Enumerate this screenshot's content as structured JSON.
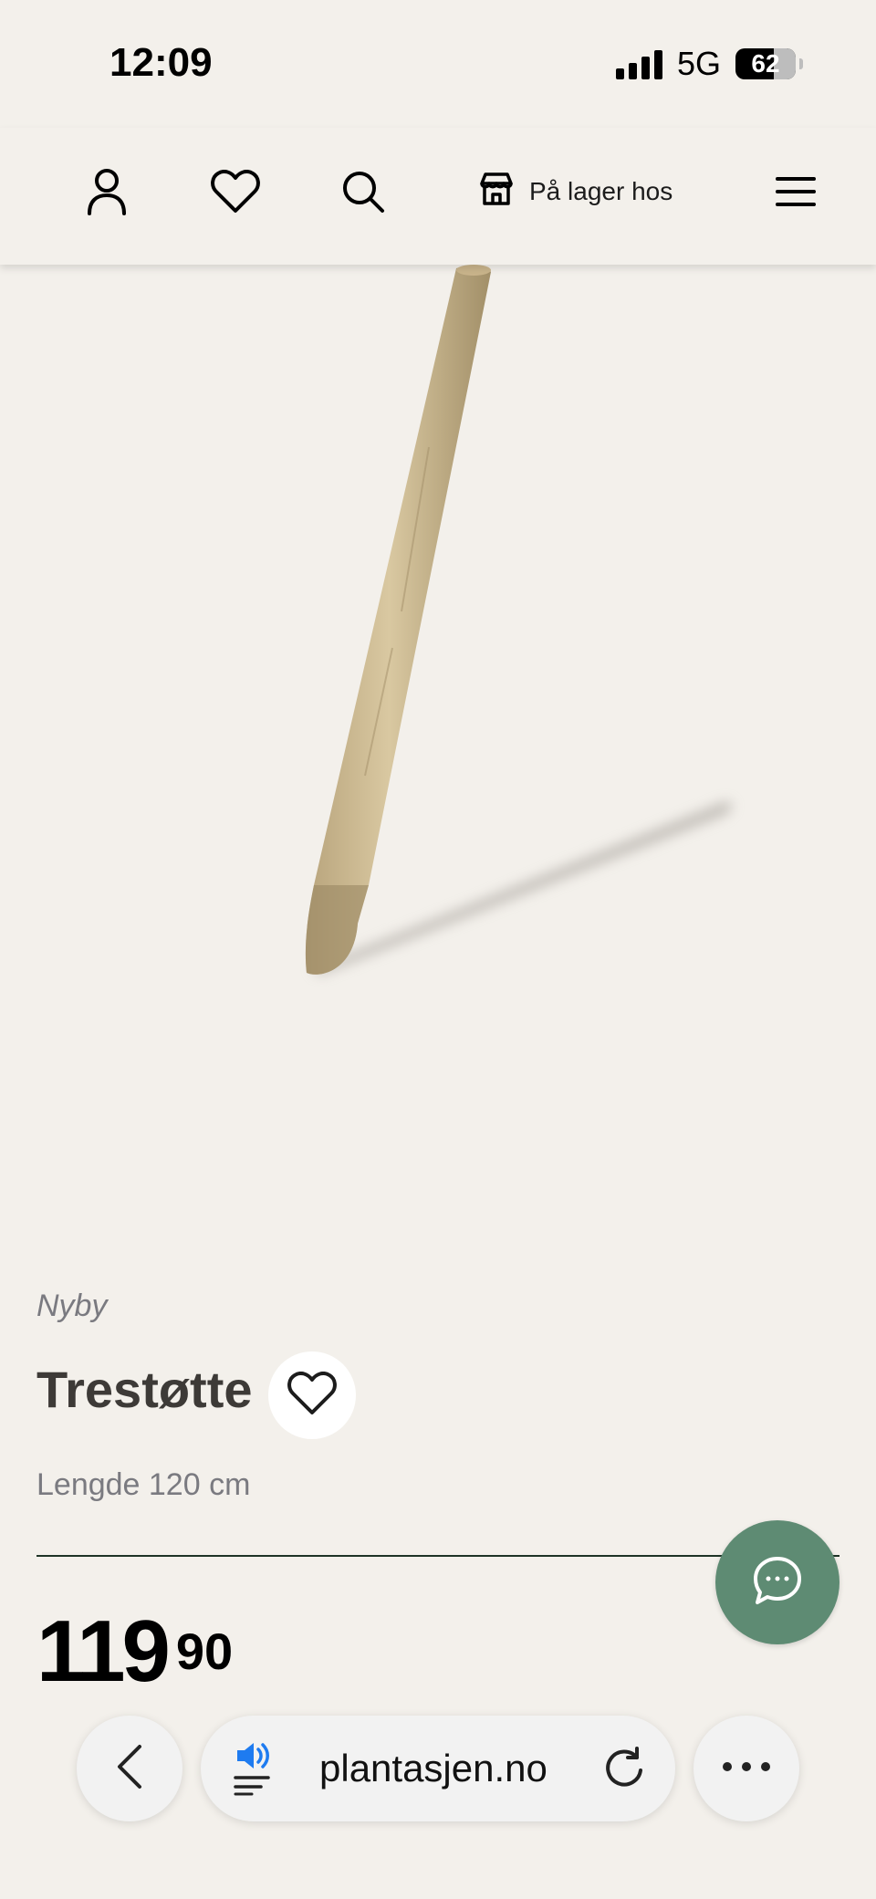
{
  "status_bar": {
    "time": "12:09",
    "network": "5G",
    "battery": "62"
  },
  "header": {
    "account_icon": "person-icon",
    "favorites_icon": "heart-icon",
    "search_icon": "search-icon",
    "store_icon": "store-icon",
    "store_label": "På lager hos",
    "menu_icon": "hamburger-menu-icon"
  },
  "product": {
    "image": "wooden-stake-image",
    "brand": "Nyby",
    "title": "Trestøtte",
    "subtitle": "Lengde 120 cm",
    "price_integer": "119",
    "price_decimal": "90"
  },
  "browser": {
    "url": "plantasjen.no",
    "back_icon": "chevron-left-icon",
    "audio_icon": "speaker-icon",
    "reload_icon": "reload-icon",
    "more_icon": "ellipsis-icon"
  },
  "colors": {
    "background": "#f3f0eb",
    "accent_green": "#5e8b73",
    "divider": "#1e3326",
    "muted_text": "#7a7a80"
  }
}
